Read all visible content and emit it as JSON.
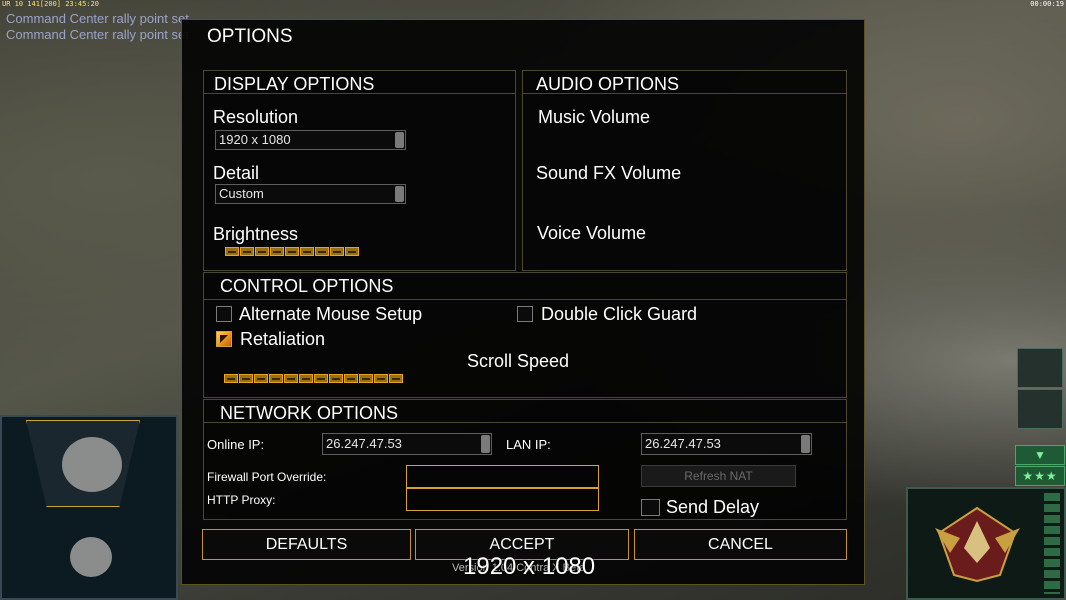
{
  "hud": {
    "top_left": "UR 10 141[200] 23:45:20",
    "top_right": "00:00:19",
    "chat_lines": [
      "Command Center rally point set",
      "Command Center rally point set"
    ]
  },
  "dialog": {
    "title": "OPTIONS",
    "display": {
      "title": "DISPLAY OPTIONS",
      "resolution_label": "Resolution",
      "resolution_value": "1920 x 1080",
      "detail_label": "Detail",
      "detail_value": "Custom",
      "brightness_label": "Brightness",
      "brightness_segments": 9
    },
    "audio": {
      "title": "AUDIO OPTIONS",
      "music_label": "Music Volume",
      "sfx_label": "Sound FX Volume",
      "voice_label": "Voice Volume"
    },
    "control": {
      "title": "CONTROL OPTIONS",
      "alt_mouse_label": "Alternate Mouse Setup",
      "alt_mouse_checked": false,
      "double_click_label": "Double Click Guard",
      "double_click_checked": false,
      "retaliation_label": "Retaliation",
      "retaliation_checked": true,
      "scroll_speed_label": "Scroll Speed",
      "scroll_speed_segments": 12
    },
    "network": {
      "title": "NETWORK OPTIONS",
      "online_ip_label": "Online IP:",
      "online_ip_value": "26.247.47.53",
      "lan_ip_label": "LAN IP:",
      "lan_ip_value": "26.247.47.53",
      "firewall_label": "Firewall Port Override:",
      "firewall_value": "",
      "http_proxy_label": "HTTP Proxy:",
      "http_proxy_value": "",
      "refresh_nat_label": "Refresh NAT",
      "send_delay_label": "Send Delay",
      "send_delay_checked": false
    },
    "buttons": {
      "defaults": "DEFAULTS",
      "accept": "ACCEPT",
      "cancel": "CANCEL"
    },
    "version_text": "Version 1.04 Contra X Beta"
  },
  "overlay_resolution": "1920 x 1080",
  "colors": {
    "accent_gold": "#d8a22a",
    "panel_border": "#4a4630",
    "hud_green": "#1e5a34"
  }
}
